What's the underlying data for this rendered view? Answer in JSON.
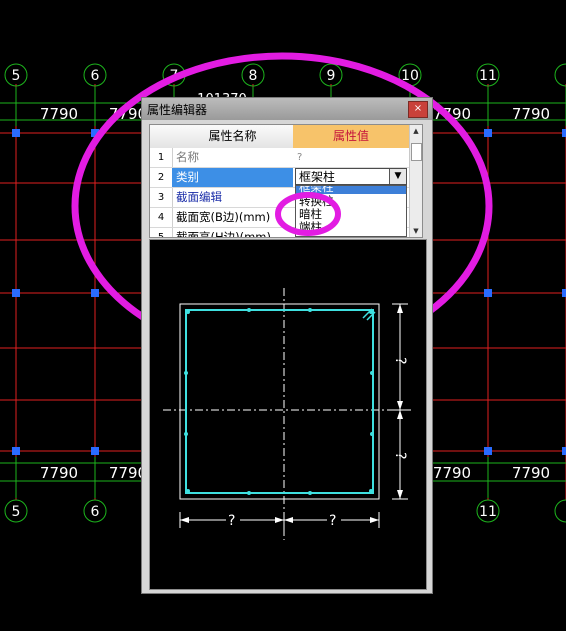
{
  "background": {
    "axis_labels_top": [
      "5",
      "6",
      "7",
      "8",
      "9",
      "10",
      "11"
    ],
    "axis_labels_bottom": [
      "5",
      "6",
      "11"
    ],
    "dimension_label": "7790",
    "partial_top_label": "101370",
    "colors": {
      "grid_red": "#e02020",
      "axis_green": "#1db41d",
      "node_blue": "#2a6bff",
      "dim_text": "#ffffff",
      "circle_magenta": "#e21ce2"
    }
  },
  "dialog": {
    "title": "属性编辑器",
    "close_label": "×",
    "columns": {
      "name": "属性名称",
      "value": "属性值"
    },
    "rows": [
      {
        "num": "1",
        "name": "名称",
        "value": "?"
      },
      {
        "num": "2",
        "name": "类别",
        "value": "框架柱"
      },
      {
        "num": "3",
        "name": "截面编辑",
        "value": ""
      },
      {
        "num": "4",
        "name": "截面宽(B边)(mm)",
        "value": ""
      },
      {
        "num": "5",
        "name": "截面高(H边)(mm)",
        "value": ""
      }
    ],
    "combo_value": "框架柱",
    "combo_arrow": "▼",
    "dropdown_options": [
      "框架柱",
      "转换柱",
      "暗柱",
      "端柱"
    ],
    "dropdown_highlighted": "框架柱",
    "scroll_up": "▲",
    "scroll_down": "▼"
  },
  "preview": {
    "dim_label": "?",
    "colors": {
      "section": "#3fe0e0",
      "dim": "#ffffff"
    }
  }
}
